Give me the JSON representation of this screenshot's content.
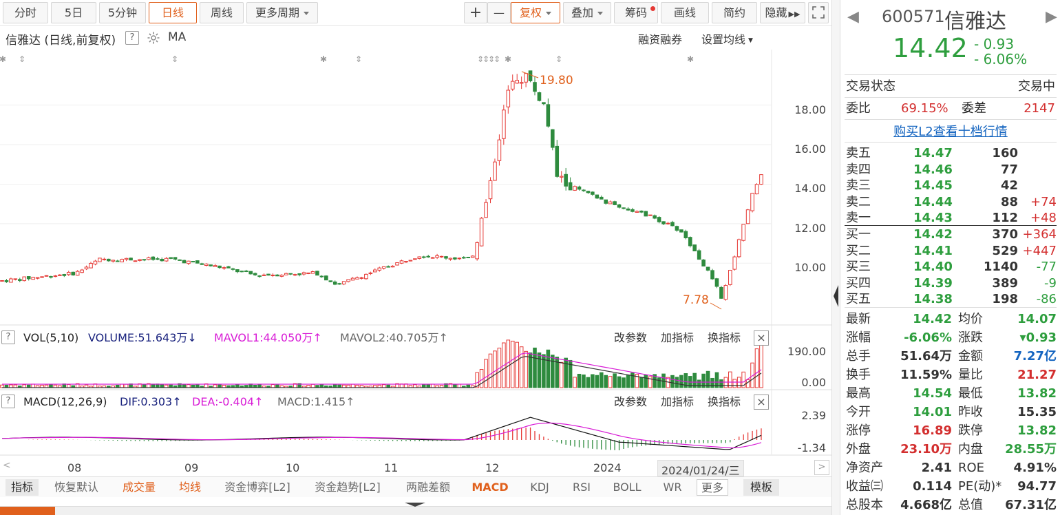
{
  "toolbar": {
    "items": [
      "分时",
      "5日",
      "5分钟",
      "日线",
      "周线",
      "更多周期"
    ],
    "plus": "+",
    "minus": "—",
    "fuquan": "复权",
    "diejia": "叠加",
    "chouma": "筹码",
    "huaxian": "画线",
    "jianyue": "简约",
    "yincang": "隐藏"
  },
  "chart_head": {
    "title": "信雅达 (日线,前复权)",
    "help": "?",
    "ma": "MA",
    "rzrq": "融资融券",
    "set_ma": "设置均线"
  },
  "price_axis": [
    "18.00",
    "16.00",
    "14.00",
    "12.00",
    "10.00"
  ],
  "annotations": {
    "high": "19.80",
    "low": "7.78"
  },
  "vol_pane": {
    "help": "?",
    "name": "VOL(5,10)",
    "volume": "VOLUME:51.643万",
    "vol_arrow": "↓",
    "mavol1": "MAVOL1:44.050万",
    "mavol1_arrow": "↑",
    "mavol2": "MAVOL2:40.705万",
    "mavol2_arrow": "↑",
    "axis": [
      "190.00",
      "0.00"
    ]
  },
  "macd_pane": {
    "help": "?",
    "name": "MACD(12,26,9)",
    "dif": "DIF:0.303",
    "dif_arrow": "↑",
    "dea": "DEA:-0.404",
    "dea_arrow": "↑",
    "macd": "MACD:1.415",
    "macd_arrow": "↑",
    "axis": [
      "2.39",
      "-1.34"
    ]
  },
  "pane_buttons": {
    "params": "改参数",
    "add": "加指标",
    "swap": "换指标",
    "close": "×"
  },
  "time_axis": {
    "labels": [
      "08",
      "09",
      "10",
      "11",
      "12",
      "2024"
    ],
    "cursor": "2024/01/24/三"
  },
  "bottom_tabs": [
    "指标",
    "恢复默认",
    "成交量",
    "均线",
    "资金博弈[L2]",
    "资金趋势[L2]",
    "两融差额",
    "MACD",
    "KDJ",
    "RSI",
    "BOLL",
    "WR",
    "更多",
    "模板"
  ],
  "quote": {
    "code": "600571",
    "name": "信雅达",
    "price": "14.42",
    "change": "- 0.93",
    "change_pct": "- 6.06%",
    "status_label": "交易状态",
    "status": "交易中",
    "weibi_label": "委比",
    "weibi": "69.15%",
    "weicha_label": "委差",
    "weicha": "2147",
    "l2_link": "购买L2查看十档行情"
  },
  "order_book": {
    "asks": [
      {
        "label": "卖五",
        "price": "14.47",
        "vol": "160",
        "chg": ""
      },
      {
        "label": "卖四",
        "price": "14.46",
        "vol": "77",
        "chg": ""
      },
      {
        "label": "卖三",
        "price": "14.45",
        "vol": "42",
        "chg": ""
      },
      {
        "label": "卖二",
        "price": "14.44",
        "vol": "88",
        "chg": "+74"
      },
      {
        "label": "卖一",
        "price": "14.43",
        "vol": "112",
        "chg": "+48"
      }
    ],
    "bids": [
      {
        "label": "买一",
        "price": "14.42",
        "vol": "370",
        "chg": "+364"
      },
      {
        "label": "买二",
        "price": "14.41",
        "vol": "529",
        "chg": "+447"
      },
      {
        "label": "买三",
        "price": "14.40",
        "vol": "1140",
        "chg": "-77"
      },
      {
        "label": "买四",
        "price": "14.39",
        "vol": "389",
        "chg": "-9"
      },
      {
        "label": "买五",
        "price": "14.38",
        "vol": "198",
        "chg": "-86"
      }
    ]
  },
  "stats": [
    {
      "l1": "最新",
      "v1": "14.42",
      "c1": "g",
      "l2": "均价",
      "v2": "14.07",
      "c2": "g"
    },
    {
      "l1": "涨幅",
      "v1": "-6.06%",
      "c1": "g",
      "l2": "涨跌",
      "v2": "▾0.93",
      "c2": "g"
    },
    {
      "l1": "总手",
      "v1": "51.64万",
      "c1": "k",
      "l2": "金额",
      "v2": "7.27亿",
      "c2": "b"
    },
    {
      "l1": "换手",
      "v1": "11.59%",
      "c1": "k",
      "l2": "量比",
      "v2": "21.27",
      "c2": "r"
    },
    {
      "l1": "最高",
      "v1": "14.54",
      "c1": "g",
      "l2": "最低",
      "v2": "13.82",
      "c2": "g"
    },
    {
      "l1": "今开",
      "v1": "14.01",
      "c1": "g",
      "l2": "昨收",
      "v2": "15.35",
      "c2": "k"
    },
    {
      "l1": "涨停",
      "v1": "16.89",
      "c1": "r",
      "l2": "跌停",
      "v2": "13.82",
      "c2": "g"
    },
    {
      "l1": "外盘",
      "v1": "23.10万",
      "c1": "r",
      "l2": "内盘",
      "v2": "28.55万",
      "c2": "g"
    },
    {
      "l1": "净资产",
      "v1": "2.41",
      "c1": "k",
      "l2": "ROE",
      "v2": "4.91%",
      "c2": "k"
    },
    {
      "l1": "收益㈢",
      "v1": "0.114",
      "c1": "k",
      "l2": "PE(动)*",
      "v2": "94.77",
      "c2": "k"
    },
    {
      "l1": "总股本",
      "v1": "4.668亿",
      "c1": "k",
      "l2": "总值",
      "v2": "67.31亿",
      "c2": "k"
    }
  ],
  "colors": {
    "up": "#e53935",
    "down": "#2e8b3e",
    "accent": "#e0601c"
  }
}
